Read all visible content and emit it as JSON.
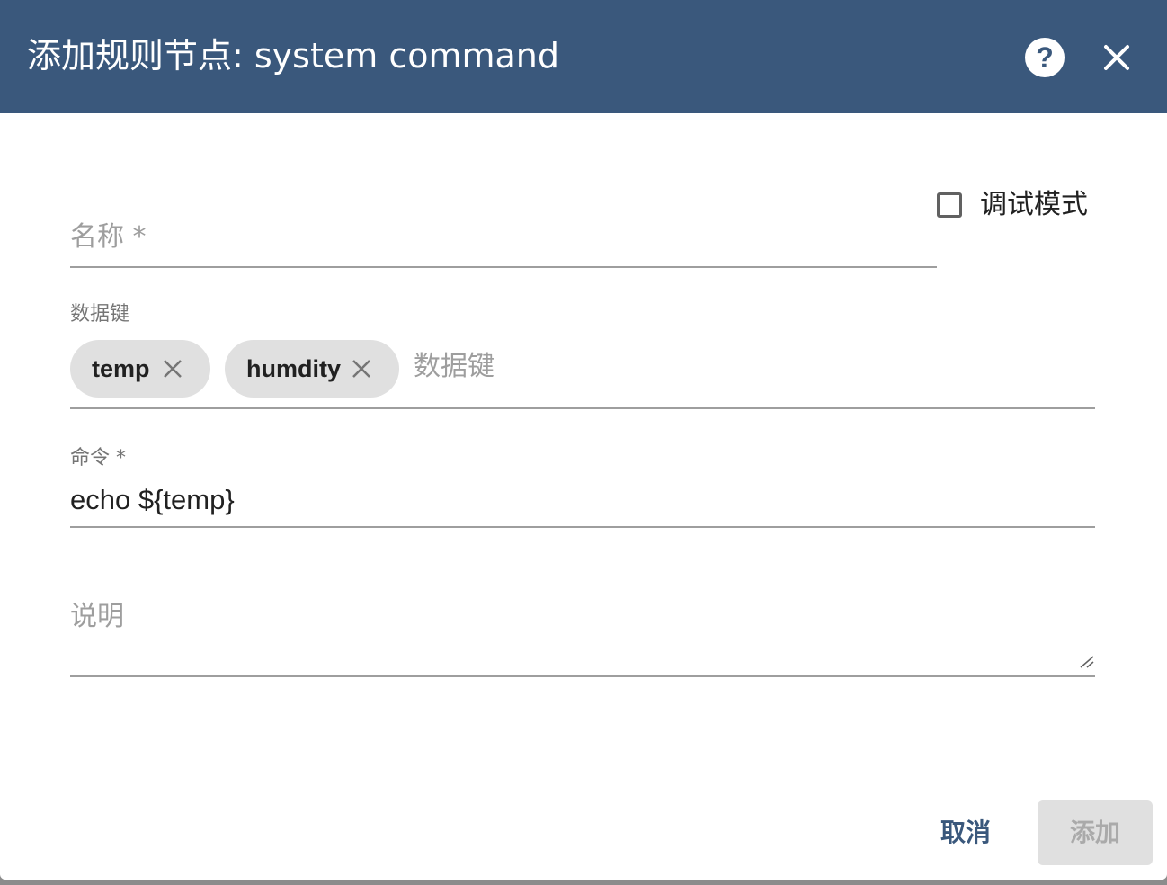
{
  "dialog": {
    "title": "添加规则节点: system command"
  },
  "header_icons": {
    "help": "help-icon",
    "close": "close-icon"
  },
  "form": {
    "name_label": "名称 *",
    "debug_mode_label": "调试模式",
    "debug_mode_checked": false,
    "data_keys_label": "数据键",
    "data_keys_chips": [
      "temp",
      "humdity"
    ],
    "data_keys_placeholder": "数据键",
    "command_label": "命令 *",
    "command_value": "echo ${temp}",
    "description_label": "说明"
  },
  "actions": {
    "cancel_label": "取消",
    "add_label": "添加"
  },
  "colors": {
    "header": "#3a587c",
    "primary_text": "#3a587c",
    "disabled_button_bg": "#e0e0e0"
  }
}
